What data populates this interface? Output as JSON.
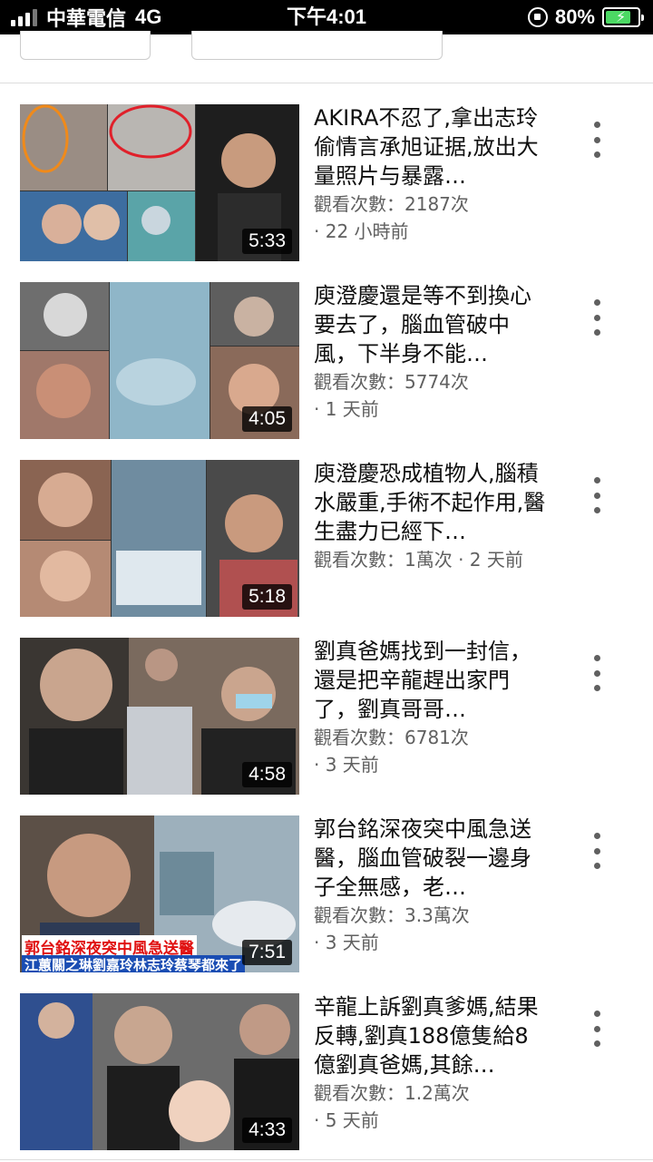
{
  "status_bar": {
    "carrier": "中華電信",
    "network": "4G",
    "time": "下午4:01",
    "battery": "80%"
  },
  "videos": [
    {
      "title": "AKIRA不忍了,拿出志玲偷情言承旭证据,放出大量照片与暴露…",
      "views": "觀看次數：2187次",
      "age": "· 22 小時前",
      "duration": "5:33"
    },
    {
      "title": "庾澄慶還是等不到換心要去了，腦血管破中風，下半身不能…",
      "views": "觀看次數：5774次",
      "age": "· 1 天前",
      "duration": "4:05"
    },
    {
      "title": "庾澄慶恐成植物人,腦積水嚴重,手術不起作用,醫生盡力已經下…",
      "views": "觀看次數：1萬次 · 2 天前",
      "age": "",
      "duration": "5:18"
    },
    {
      "title": "劉真爸媽找到一封信，還是把辛龍趕出家門了，劉真哥哥…",
      "views": "觀看次數：6781次",
      "age": "· 3 天前",
      "duration": "4:58"
    },
    {
      "title": "郭台銘深夜突中風急送醫，腦血管破裂一邊身子全無感，老…",
      "views": "觀看次數：3.3萬次",
      "age": "· 3 天前",
      "duration": "7:51",
      "thumb_caption_1": "郭台銘深夜突中風急送醫",
      "thumb_caption_2": "江蕙關之琳劉嘉玲林志玲蔡琴都來了"
    },
    {
      "title": "辛龍上訴劉真爹媽,結果反轉,劉真188億隻給8億劉真爸媽,其餘…",
      "views": "觀看次數：1.2萬次",
      "age": "· 5 天前",
      "duration": "4:33"
    }
  ]
}
